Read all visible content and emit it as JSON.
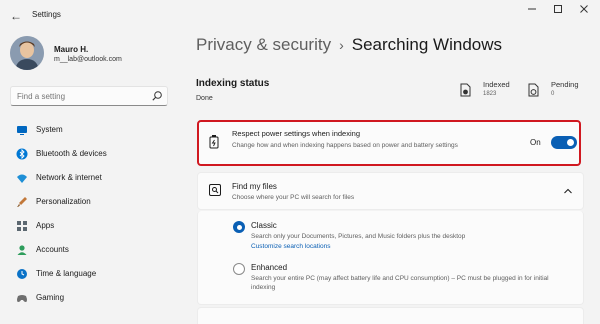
{
  "window": {
    "title": "Settings",
    "back_glyph": "←",
    "controls": [
      "minimize-icon",
      "maximize-icon",
      "close-icon"
    ]
  },
  "profile": {
    "name": "Mauro H.",
    "email": "m__lab@outlook.com"
  },
  "search": {
    "placeholder": "Find a setting"
  },
  "sidebar": {
    "items": [
      {
        "label": "System",
        "icon": "system-icon",
        "color": "#0067c0"
      },
      {
        "label": "Bluetooth & devices",
        "icon": "bluetooth-icon",
        "color": "#0078d4"
      },
      {
        "label": "Network & internet",
        "icon": "network-icon",
        "color": "#1e8fd6"
      },
      {
        "label": "Personalization",
        "icon": "brush-icon",
        "color": "#c2783a"
      },
      {
        "label": "Apps",
        "icon": "apps-icon",
        "color": "#5b6770"
      },
      {
        "label": "Accounts",
        "icon": "accounts-icon",
        "color": "#2e9d5c"
      },
      {
        "label": "Time & language",
        "icon": "globe-clock-icon",
        "color": "#0a72c7"
      },
      {
        "label": "Gaming",
        "icon": "gaming-icon",
        "color": "#6e6e6e"
      }
    ]
  },
  "breadcrumb": {
    "parent": "Privacy & security",
    "separator": "›",
    "current": "Searching Windows"
  },
  "indexing": {
    "title": "Indexing status",
    "state": "Done",
    "indexed_label": "Indexed",
    "indexed_value": "1823",
    "pending_label": "Pending",
    "pending_value": "0"
  },
  "power": {
    "title": "Respect power settings when indexing",
    "description": "Change how and when indexing happens based on power and battery settings",
    "toggle_label": "On",
    "toggle_on": true
  },
  "find_files": {
    "title": "Find my files",
    "description": "Choose where your PC will search for files",
    "options": [
      {
        "title": "Classic",
        "description": "Search only your Documents, Pictures, and Music folders plus the desktop",
        "link": "Customize search locations",
        "selected": true
      },
      {
        "title": "Enhanced",
        "description": "Search your entire PC (may affect battery life and CPU consumption) – PC must be plugged in for initial indexing",
        "selected": false
      }
    ]
  },
  "colors": {
    "accent": "#0a5fb4",
    "highlight_border": "#d01820"
  }
}
